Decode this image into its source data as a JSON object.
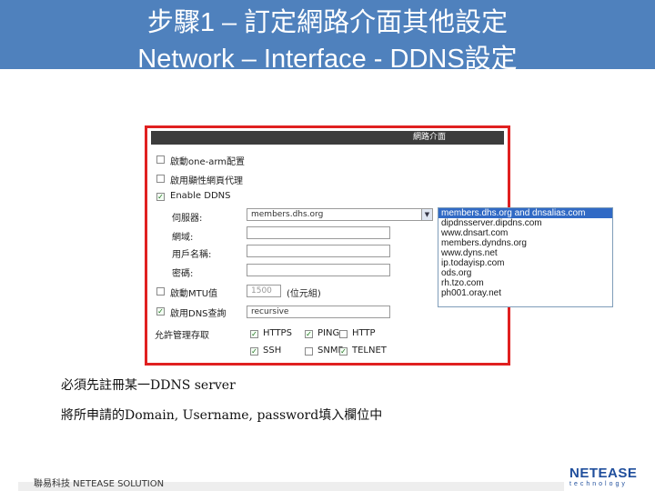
{
  "slide": {
    "title_line1": "步驟1 – 訂定網路介面其他設定",
    "title_line2": "Network – Interface - DDNS設定"
  },
  "panel": {
    "header": "網路介面",
    "options": {
      "one_arm": "啟動one-arm配置",
      "proxy": "啟用顯性網頁代理",
      "enable_ddns": "Enable DDNS",
      "mtu": "啟動MTU值",
      "dns": "啟用DNS查詢"
    },
    "fields": {
      "server_label": "伺服器:",
      "server_value": "members.dhs.org",
      "domain_label": "網域:",
      "username_label": "用戶名稱:",
      "password_label": "密碼:",
      "mtu_value": "1500",
      "mtu_unit": "(位元組)",
      "dns_value": "recursive"
    },
    "admin": {
      "label": "允許管理存取",
      "https": "HTTPS",
      "ping": "PING",
      "http": "HTTP",
      "ssh": "SSH",
      "snmp": "SNMP",
      "telnet": "TELNET"
    }
  },
  "dropdown": {
    "options": [
      "members.dhs.org and dnsalias.com",
      "dipdnsserver.dipdns.com",
      "www.dnsart.com",
      "members.dyndns.org",
      "www.dyns.net",
      "ip.todayisp.com",
      "ods.org",
      "rh.tzo.com",
      "ph001.oray.net"
    ]
  },
  "notes": {
    "line1": "必須先註冊某一DDNS server",
    "line2": "將所申請的Domain, Username, password填入欄位中"
  },
  "footer": {
    "company": "聯易科技 NETEASE SOLUTION",
    "logo_main": "NETEASE",
    "logo_sub": "technology"
  }
}
